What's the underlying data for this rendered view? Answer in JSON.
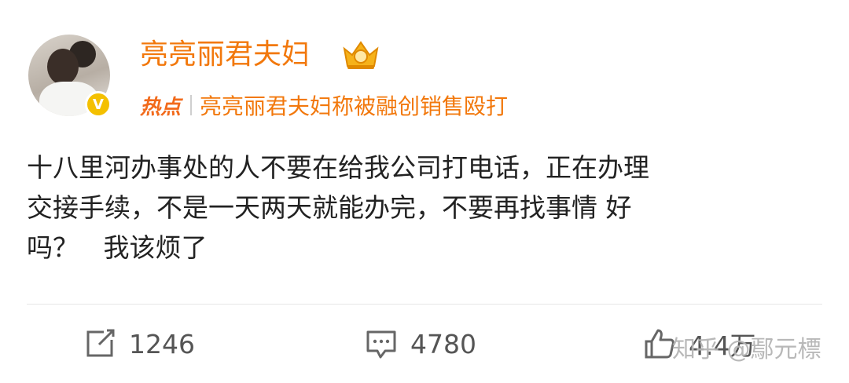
{
  "post": {
    "username": "亮亮丽君夫妇",
    "hot_tag": "热点",
    "hot_topic": "亮亮丽君夫妇称被融创销售殴打",
    "text": "十八里河办事处的人不要在给我公司打电话，正在办理\n交接手续，不是一天两天就能办完，不要再找事情 好\n吗？   我该烦了"
  },
  "actions": {
    "reposts": "1246",
    "comments": "4780",
    "likes": "4.4万"
  },
  "watermark": "知乎 @鄢元標",
  "icons": {
    "crown": "crown-icon",
    "verified": "verified-badge-icon",
    "repost": "share-icon",
    "comment": "comment-icon",
    "like": "thumbs-up-icon"
  },
  "colors": {
    "username": "#f2780c",
    "hot_tag": "#f26a1b",
    "verified": "#f4c000"
  }
}
